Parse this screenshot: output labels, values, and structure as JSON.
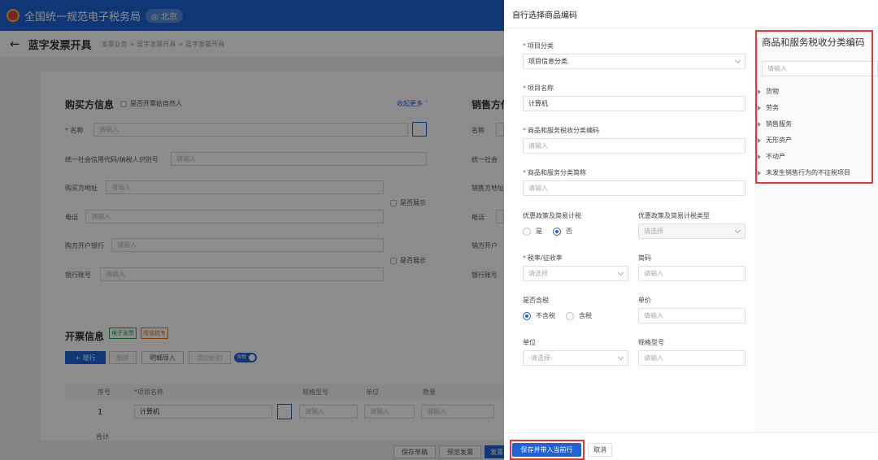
{
  "header": {
    "system_name": "全国统一规范电子税务局",
    "city": "北京"
  },
  "subbar": {
    "title": "蓝字发票开具",
    "breadcrumb": "发票业务 > 蓝字发票开具 > 蓝字发票开具"
  },
  "buyer": {
    "title": "购买方信息",
    "natural_person": "是否开票给自然人",
    "collapse": "收起更多",
    "fields": [
      "名称",
      "统一社会信用代码/纳税人识别号",
      "购买方地址",
      "电话",
      "购方开户银行",
      "银行账号"
    ],
    "placeholder": "请输入",
    "show_label": "是否展示"
  },
  "seller": {
    "title": "销售方信",
    "fields": [
      "名称",
      "统一社会",
      "销售方地址",
      "电话",
      "销方开户",
      "银行账号"
    ]
  },
  "invoice": {
    "title": "开票信息",
    "tag_electronic": "电子发票",
    "tag_special": "增值税专",
    "add_row": "+ 增行",
    "delete": "删除",
    "import_detail": "明细导入",
    "add_discount": "添加折扣",
    "toggle_label": "含税",
    "columns": [
      "序号",
      "项目名称",
      "规格型号",
      "单位",
      "数量"
    ],
    "row_index": "1",
    "row_name": "计算机",
    "total": "合计"
  },
  "bottom": {
    "save_draft": "保存草稿",
    "preview": "预览发票",
    "issue": "发票"
  },
  "drawer": {
    "title": "自行选择商品编码",
    "project_category": {
      "label": "项目分类",
      "value": "项目信息分类"
    },
    "project_name": {
      "label": "项目名称",
      "value": "计算机"
    },
    "tax_code": {
      "label": "商品和服务税收分类编码",
      "placeholder": "请输入"
    },
    "short_name": {
      "label": "商品和服务分类简称",
      "placeholder": "请输入"
    },
    "preferential": {
      "label": "优惠政策及简易计税",
      "yes": "是",
      "no": "否"
    },
    "preferential_type": {
      "label": "优惠政策及简易计税类型",
      "placeholder": "请选择"
    },
    "tax_rate": {
      "label": "税率/征收率",
      "placeholder": "请选择"
    },
    "abbreviation": {
      "label": "简码",
      "placeholder": "请输入"
    },
    "tax_included": {
      "label": "是否含税",
      "excl": "不含税",
      "incl": "含税"
    },
    "unit_price": {
      "label": "单价",
      "placeholder": "请输入"
    },
    "unit": {
      "label": "单位",
      "placeholder": "-请选择-"
    },
    "spec": {
      "label": "规格型号",
      "placeholder": "请输入"
    },
    "tree": {
      "title": "商品和服务税收分类编码",
      "search_placeholder": "请输入",
      "items": [
        "货物",
        "劳务",
        "销售服务",
        "无形资产",
        "不动产",
        "未发生销售行为的不征税项目"
      ]
    },
    "save_button": "保存并带入当前行",
    "cancel_button": "取消"
  },
  "colors": {
    "primary": "#1f63d6",
    "highlight": "#e53935",
    "required": "#e0453a"
  }
}
